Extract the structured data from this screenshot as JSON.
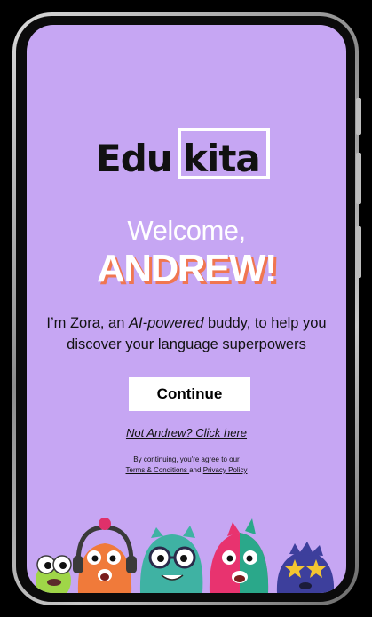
{
  "app": {
    "logo_part_1": "Edu",
    "logo_part_2": "kita"
  },
  "welcome": {
    "greeting": "Welcome,",
    "user_name": "ANDREW!",
    "intro_pre": "I’m Zora, an ",
    "intro_emphasis": "AI-powered",
    "intro_post": " buddy, to help you discover your language superpowers"
  },
  "actions": {
    "continue_label": "Continue",
    "not_user_link": "Not Andrew? Click here"
  },
  "legal": {
    "prefix": "By continuing, you're agree to our",
    "terms_link": "Terms & Conditions ",
    "conjunction": "and",
    "privacy_link": "Privacy Policy"
  },
  "colors": {
    "screen_background": "#c6a6f3",
    "name_shadow": "#f07650",
    "button_background": "#ffffff"
  },
  "icons": [
    "green-monster-icon",
    "orange-monster-icon",
    "teal-monster-icon",
    "pink-monster-icon",
    "blue-monster-icon"
  ]
}
